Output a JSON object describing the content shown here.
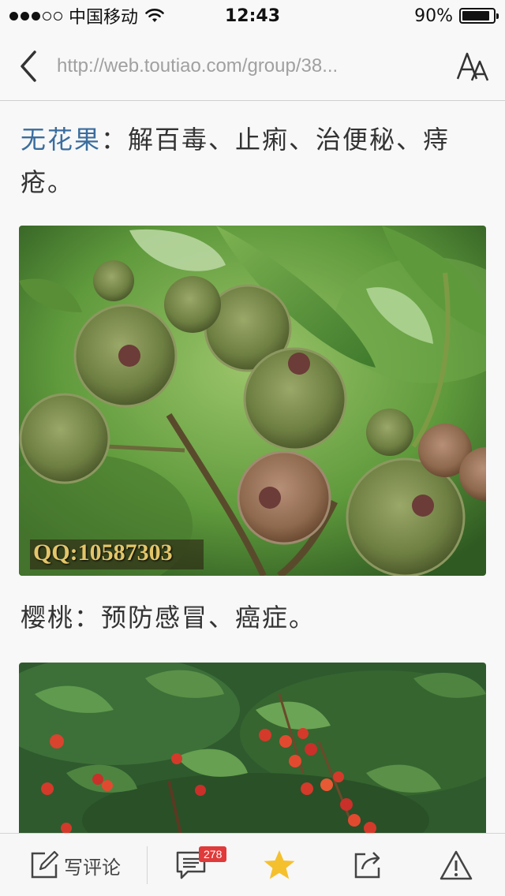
{
  "status_bar": {
    "carrier": "中国移动",
    "time": "12:43",
    "battery_percent_text": "90%",
    "battery_level": 0.9,
    "signal_bars": 3,
    "signal_total": 5
  },
  "nav": {
    "url": "http://web.toutiao.com/group/38...",
    "back_icon": "chevron-left-icon",
    "font_icon": "font-size-icon"
  },
  "article": {
    "p1_link": "无花果",
    "p1_rest": "：解百毒、止痢、治便秘、痔疮。",
    "image1_watermark": "QQ:10587303",
    "p2": "樱桃：预防感冒、癌症。"
  },
  "toolbar": {
    "write_comment": "写评论",
    "comment_count": "278",
    "icons": [
      "pencil-icon",
      "comment-icon",
      "star-icon",
      "share-icon",
      "report-icon"
    ],
    "star_color": "#f5c02e",
    "badge_color": "#e03a3a"
  },
  "colors": {
    "link": "#3a6d9e",
    "background": "#f8f8f8"
  }
}
